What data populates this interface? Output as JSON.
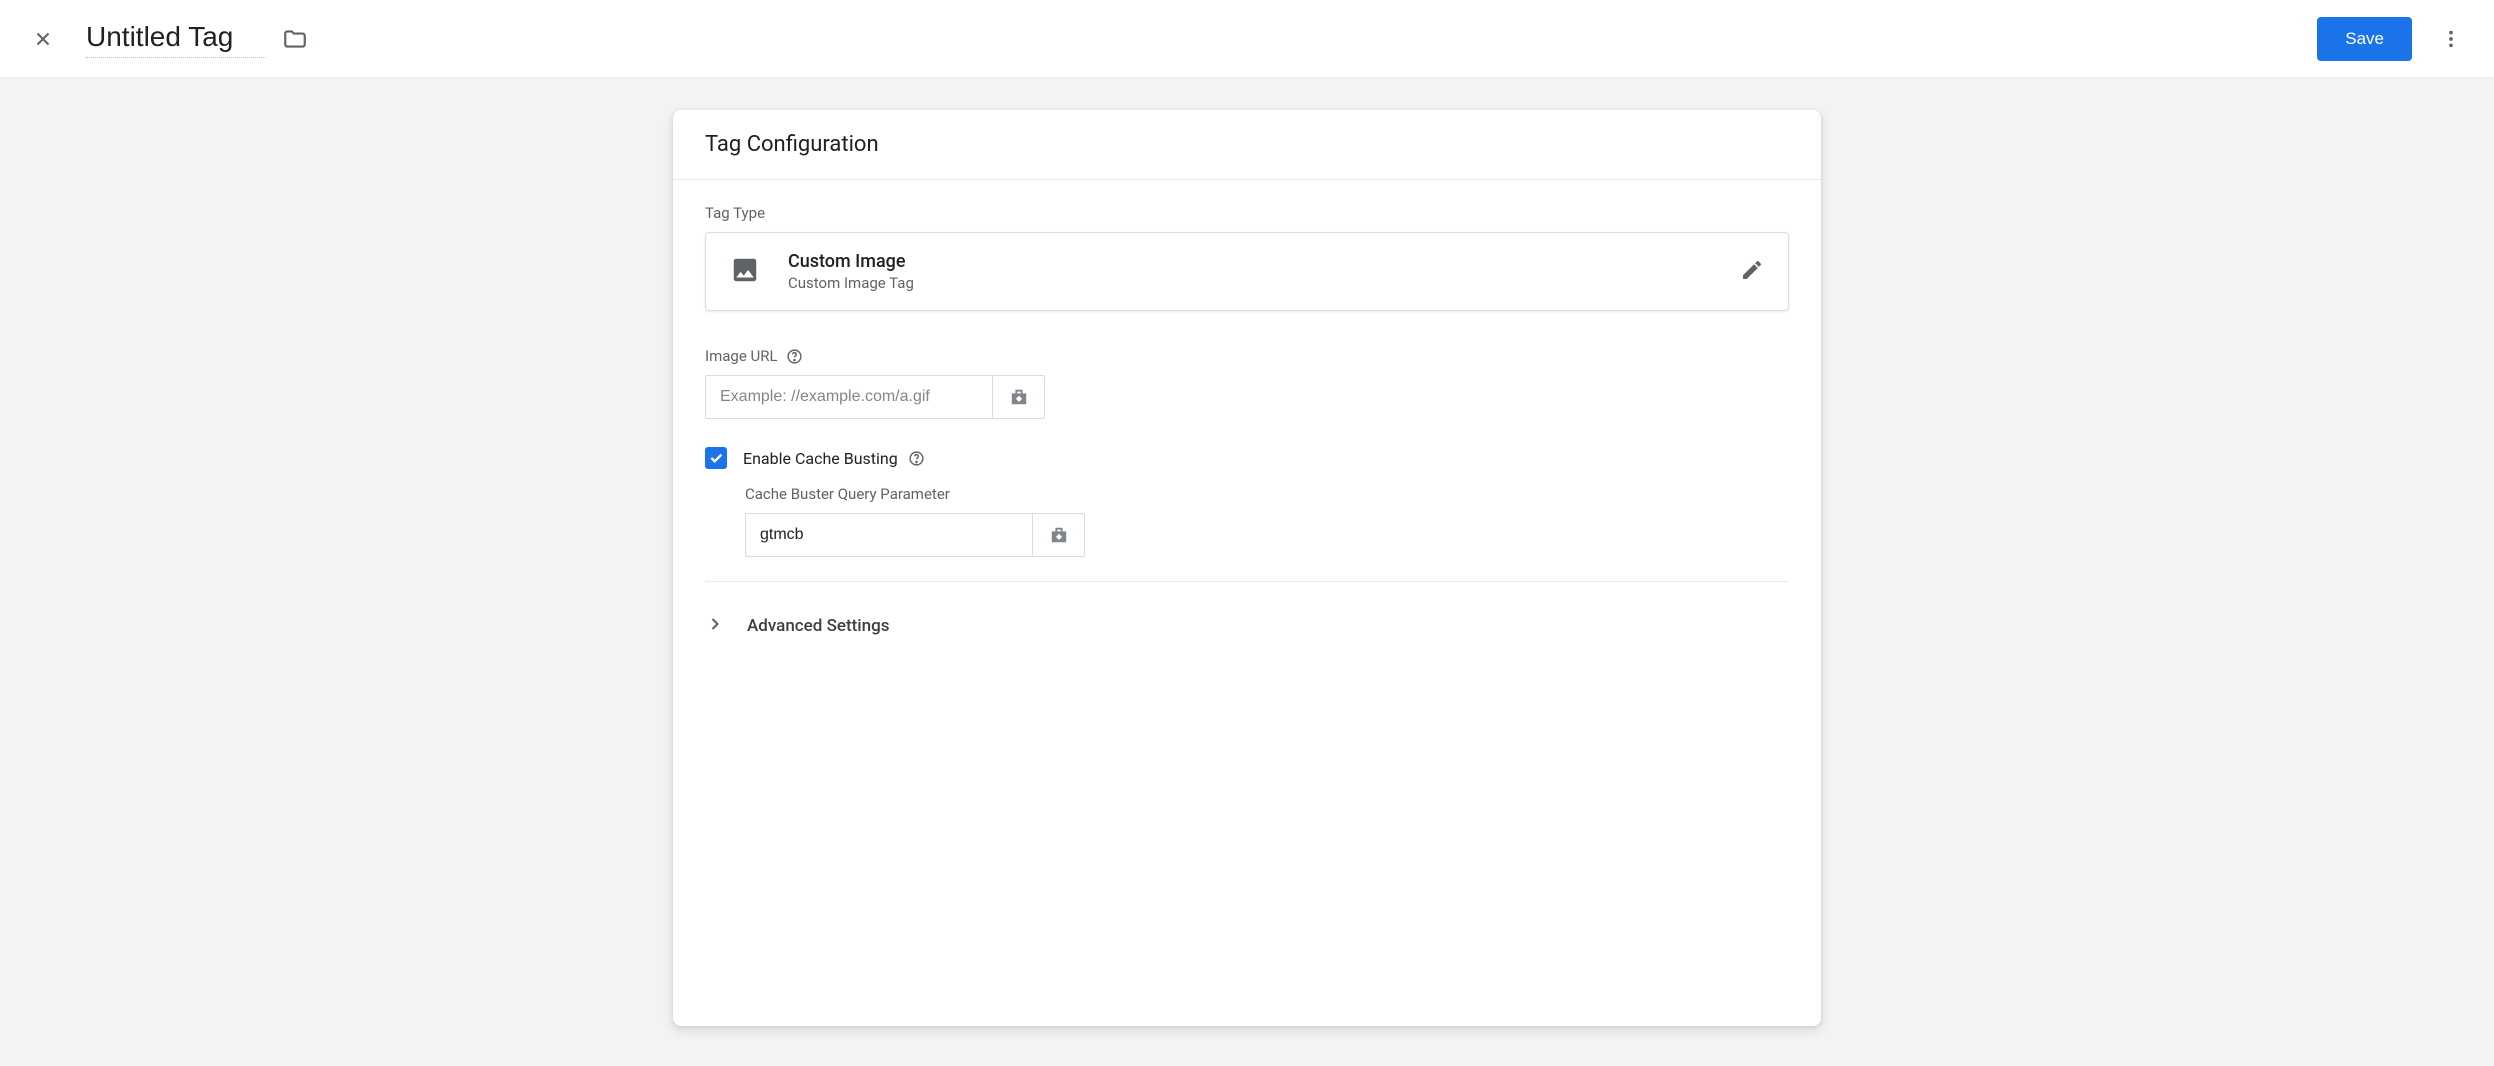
{
  "header": {
    "title_value": "Untitled Tag",
    "save_label": "Save"
  },
  "panel": {
    "title": "Tag Configuration",
    "tag_type_label": "Tag Type",
    "tag_type": {
      "name": "Custom Image",
      "subtitle": "Custom Image Tag"
    },
    "image_url": {
      "label": "Image URL",
      "placeholder": "Example: //example.com/a.gif",
      "value": ""
    },
    "cache_busting": {
      "checkbox_label": "Enable Cache Busting",
      "checked": true,
      "param_label": "Cache Buster Query Parameter",
      "param_value": "gtmcb"
    },
    "advanced_label": "Advanced Settings"
  }
}
